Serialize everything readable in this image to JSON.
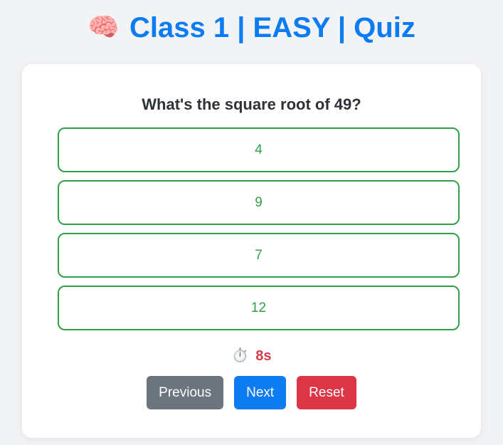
{
  "header": {
    "icon": "brain-icon",
    "icon_glyph": "🧠",
    "title": "Class 1 | EASY | Quiz"
  },
  "quiz": {
    "question": "What's the square root of 49?",
    "options": [
      {
        "label": "4"
      },
      {
        "label": "9"
      },
      {
        "label": "7"
      },
      {
        "label": "12"
      }
    ],
    "option_color": "#32a04a"
  },
  "timer": {
    "icon": "stopwatch-icon",
    "icon_glyph": "⏱️",
    "value": "8s",
    "color": "#d63a4a"
  },
  "controls": {
    "previous_label": "Previous",
    "next_label": "Next",
    "reset_label": "Reset"
  },
  "colors": {
    "title": "#0d7bf2",
    "previous": "#6c757d",
    "next": "#0d7bf2",
    "reset": "#dc3545"
  }
}
